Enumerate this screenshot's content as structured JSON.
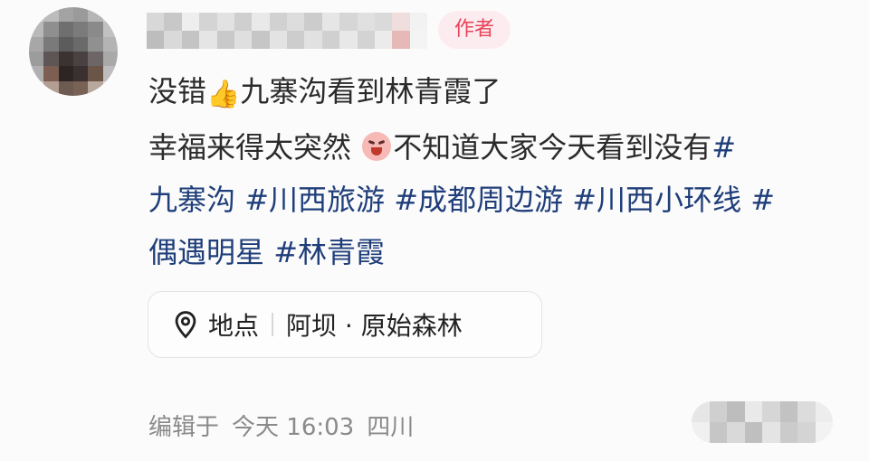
{
  "comment": {
    "author_badge": "作者",
    "line1_pre": "没错",
    "line1_emoji": "👍",
    "line1_post": "九寨沟看到林青霞了",
    "line2_pre": "幸福来得太突然",
    "line2_post": "不知道大家今天看到没有",
    "line2_tag_hash": "#",
    "line3_tags": [
      "九寨沟",
      "#川西旅游",
      "#成都周边游",
      "#川西小环线",
      "#"
    ],
    "line4_tags": [
      "偶遇明星",
      "#林青霞"
    ]
  },
  "location": {
    "label": "地点",
    "place": "阿坝 · 原始森林"
  },
  "meta": {
    "edited": "编辑于",
    "time": "今天 16:03",
    "region": "四川"
  },
  "colors": {
    "tag": "#1f3e7a",
    "badge_text": "#e8435a",
    "badge_bg": "#fdecef"
  }
}
